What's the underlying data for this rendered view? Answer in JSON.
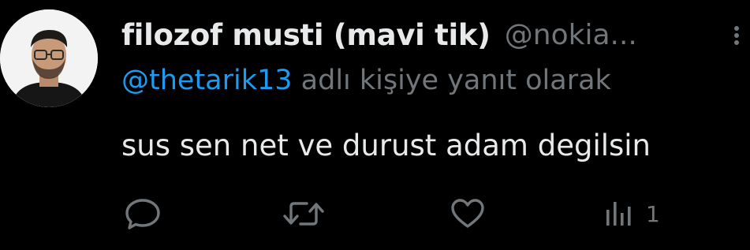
{
  "author": {
    "display_name": "filozof musti (mavi tik)",
    "handle": "@nokia..."
  },
  "reply_context": {
    "mention": "@thetarik13",
    "suffix": " adlı kişiye yanıt olarak"
  },
  "tweet": {
    "text": "sus sen net ve durust adam degilsin"
  },
  "actions": {
    "reply_icon": "comment-icon",
    "retweet_icon": "retweet-icon",
    "like_icon": "heart-icon",
    "views_icon": "views-chart-icon",
    "views_count": "1"
  },
  "colors": {
    "background": "#000000",
    "primary_text": "#e7e9ea",
    "secondary_text": "#71767b",
    "mention": "#1d9bf0"
  }
}
